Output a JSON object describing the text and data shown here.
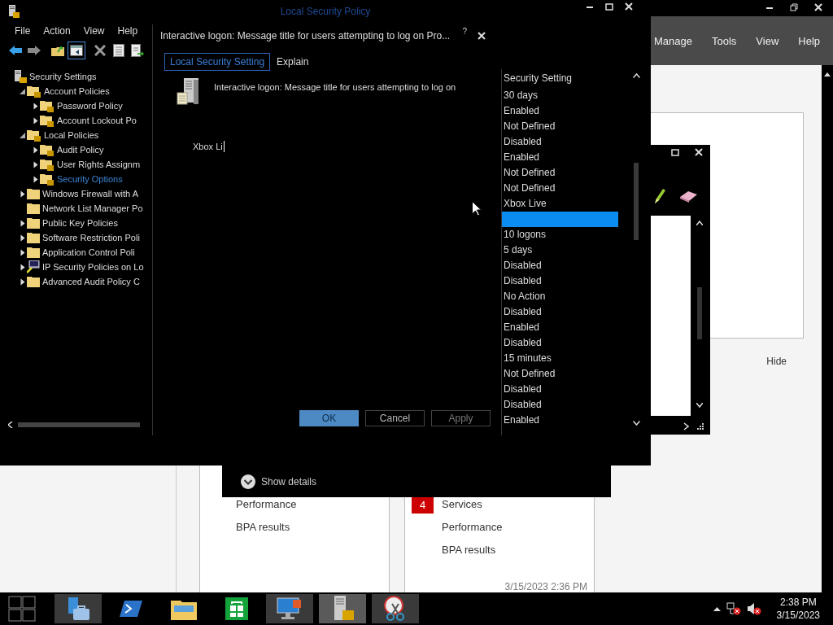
{
  "server_manager": {
    "menu": [
      "Manage",
      "Tools",
      "View",
      "Help"
    ],
    "hide_label": "Hide",
    "left_tile": {
      "items": [
        "Performance",
        "BPA results"
      ]
    },
    "right_tile": {
      "items": [
        {
          "label": "Services",
          "badge": "4"
        },
        {
          "label": "Performance"
        },
        {
          "label": "BPA results"
        }
      ],
      "timestamp": "3/15/2023 2:36 PM"
    }
  },
  "lsp_window": {
    "title": "Local Security Policy",
    "menu": [
      "File",
      "Action",
      "View",
      "Help"
    ],
    "toolbar": [
      {
        "kind": "back",
        "selected": false
      },
      {
        "kind": "forward",
        "selected": false
      },
      {
        "kind": "up",
        "selected": false
      },
      {
        "kind": "tree-toggle",
        "selected": true
      },
      {
        "kind": "delete",
        "selected": false
      },
      {
        "kind": "properties",
        "selected": false
      },
      {
        "kind": "export",
        "selected": false
      }
    ],
    "tree": [
      {
        "label": "Security Settings",
        "kind": "root",
        "selected": false,
        "children": [
          {
            "label": "Account Policies",
            "kind": "locked-folder",
            "expanded": true,
            "selected": false,
            "children": [
              {
                "label": "Password Policy",
                "kind": "locked-folder",
                "expanded": false,
                "selected": false
              },
              {
                "label": "Account Lockout Po",
                "kind": "locked-folder",
                "expanded": false,
                "selected": false
              }
            ]
          },
          {
            "label": "Local Policies",
            "kind": "locked-folder",
            "expanded": true,
            "selected": false,
            "children": [
              {
                "label": "Audit Policy",
                "kind": "locked-folder",
                "expanded": false,
                "selected": false
              },
              {
                "label": "User Rights Assignm",
                "kind": "locked-folder",
                "expanded": false,
                "selected": false
              },
              {
                "label": "Security Options",
                "kind": "locked-folder",
                "expanded": false,
                "selected": true
              }
            ]
          },
          {
            "label": "Windows Firewall with A",
            "kind": "folder",
            "expanded": false,
            "selected": false
          },
          {
            "label": "Network List Manager Po",
            "kind": "folder",
            "selected": false
          },
          {
            "label": "Public Key Policies",
            "kind": "folder",
            "expanded": false,
            "selected": false
          },
          {
            "label": "Software Restriction Poli",
            "kind": "folder",
            "expanded": false,
            "selected": false
          },
          {
            "label": "Application Control Poli",
            "kind": "folder",
            "expanded": false,
            "selected": false
          },
          {
            "label": "IP Security Policies on Lo",
            "kind": "ip-security",
            "expanded": false,
            "selected": false
          },
          {
            "label": "Advanced Audit Policy C",
            "kind": "folder",
            "expanded": false,
            "selected": false
          }
        ]
      }
    ],
    "list": {
      "header": "Security Setting",
      "rows": [
        {
          "value": "30 days",
          "selected": false
        },
        {
          "value": "Enabled",
          "selected": false
        },
        {
          "value": "Not Defined",
          "selected": false
        },
        {
          "value": "Disabled",
          "selected": false
        },
        {
          "value": "Enabled",
          "selected": false
        },
        {
          "value": "Not Defined",
          "selected": false
        },
        {
          "value": "Not Defined",
          "selected": false
        },
        {
          "value": "Xbox Live",
          "selected": false
        },
        {
          "selected": true
        },
        {
          "value": "10 logons",
          "selected": false
        },
        {
          "value": "5 days",
          "selected": false
        },
        {
          "value": "Disabled",
          "selected": false
        },
        {
          "value": "Disabled",
          "selected": false
        },
        {
          "value": "No Action",
          "selected": false
        },
        {
          "value": "Disabled",
          "selected": false
        },
        {
          "value": "Enabled",
          "selected": false
        },
        {
          "value": "Disabled",
          "selected": false
        },
        {
          "value": "15 minutes",
          "selected": false
        },
        {
          "value": "Not Defined",
          "selected": false
        },
        {
          "value": "Disabled",
          "selected": false
        },
        {
          "value": "Disabled",
          "selected": false
        },
        {
          "value": "Enabled",
          "selected": false
        }
      ]
    }
  },
  "dialog": {
    "title": "Interactive logon: Message title for users attempting to log on Pro...",
    "help": "?",
    "tabs": [
      {
        "label": "Local Security Setting",
        "selected": true
      },
      {
        "label": "Explain",
        "selected": false
      }
    ],
    "description": "Interactive logon: Message title for users attempting to log on",
    "value": "Xbox Li",
    "buttons": [
      {
        "label": "OK",
        "kind": "primary",
        "disabled": false
      },
      {
        "label": "Cancel",
        "kind": "normal",
        "disabled": false
      },
      {
        "label": "Apply",
        "kind": "normal",
        "disabled": true
      }
    ]
  },
  "details_bar": {
    "label": "Show details"
  },
  "taskbar": {
    "apps": [
      {
        "kind": "server-manager",
        "running": true,
        "selected": false
      },
      {
        "kind": "powershell",
        "running": false,
        "selected": false
      },
      {
        "kind": "explorer",
        "running": false,
        "selected": false
      },
      {
        "kind": "store",
        "running": false,
        "selected": false
      },
      {
        "kind": "remote-desktop",
        "running": true,
        "selected": false
      },
      {
        "kind": "security-policy",
        "running": true,
        "selected": true
      },
      {
        "kind": "snipping-tool",
        "running": true,
        "selected": false
      }
    ],
    "time": "2:38 PM",
    "date": "3/15/2023"
  }
}
